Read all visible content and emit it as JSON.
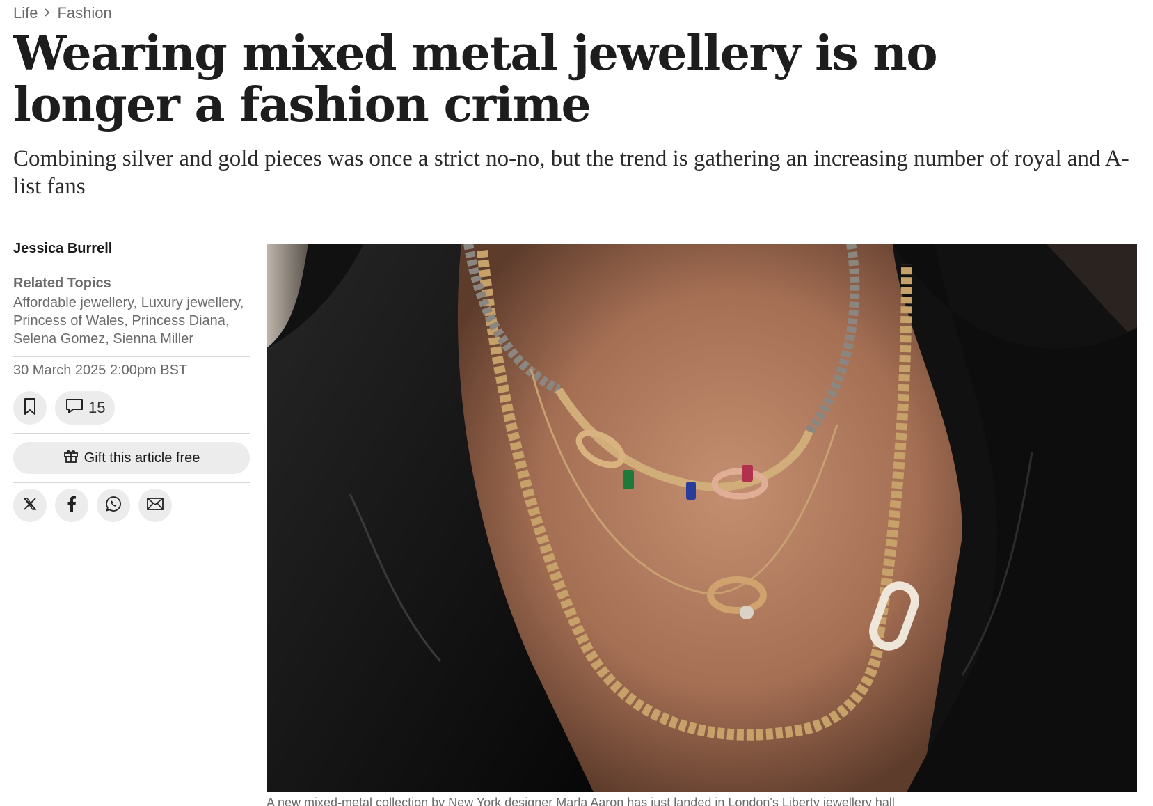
{
  "breadcrumb": {
    "section": "Life",
    "subsection": "Fashion"
  },
  "article": {
    "headline": "Wearing mixed metal jewellery is no longer a fashion crime",
    "standfirst": "Combining silver and gold pieces was once a strict no-no, but the trend is gathering an increasing number of royal and A-list fans",
    "author": "Jessica Burrell",
    "related_topics_title": "Related Topics",
    "related_topics": "Affordable jewellery, Luxury jewellery, Princess of Wales, Princess Diana, Selena Gomez, Sienna Miller",
    "date": "30 March 2025 2:00pm BST",
    "comment_count": "15",
    "gift_label": "Gift this article free",
    "caption": "A new mixed-metal collection by New York designer Marla Aaron has just landed in London's Liberty jewellery hall"
  },
  "icons": {
    "bookmark": "bookmark-icon",
    "comment": "comment-icon",
    "gift": "gift-icon",
    "share": [
      "x-icon",
      "facebook-icon",
      "whatsapp-icon",
      "email-icon"
    ]
  },
  "colors": {
    "text": "#1a1a1a",
    "muted": "#6b6b6b",
    "button_bg": "#ececec",
    "divider": "#d8d8d8"
  }
}
